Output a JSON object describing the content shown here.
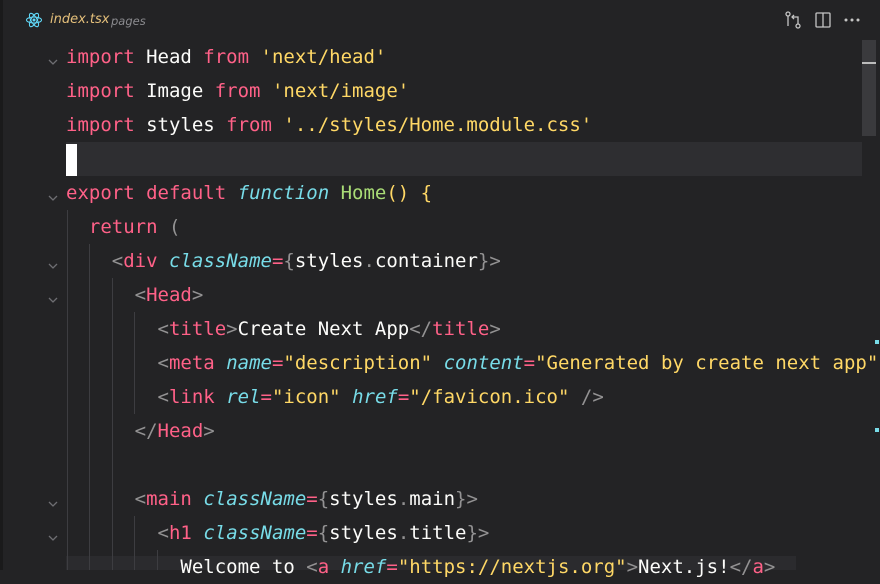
{
  "tab": {
    "filename": "index.tsx",
    "directory": "pages"
  },
  "lines": [
    [
      {
        "t": "import",
        "c": "kw"
      },
      {
        "t": " Head ",
        "c": "plain"
      },
      {
        "t": "from",
        "c": "kw"
      },
      {
        "t": " ",
        "c": "plain"
      },
      {
        "t": "'next/head'",
        "c": "str"
      }
    ],
    [
      {
        "t": "import",
        "c": "kw"
      },
      {
        "t": " Image ",
        "c": "plain"
      },
      {
        "t": "from",
        "c": "kw"
      },
      {
        "t": " ",
        "c": "plain"
      },
      {
        "t": "'next/image'",
        "c": "str"
      }
    ],
    [
      {
        "t": "import",
        "c": "kw"
      },
      {
        "t": " styles ",
        "c": "plain"
      },
      {
        "t": "from",
        "c": "kw"
      },
      {
        "t": " ",
        "c": "plain"
      },
      {
        "t": "'../styles/Home.module.css'",
        "c": "str"
      }
    ],
    [],
    [
      {
        "t": "export",
        "c": "kw"
      },
      {
        "t": " ",
        "c": "plain"
      },
      {
        "t": "default",
        "c": "kw"
      },
      {
        "t": " ",
        "c": "plain"
      },
      {
        "t": "function",
        "c": "italic-kw"
      },
      {
        "t": " ",
        "c": "plain"
      },
      {
        "t": "Home",
        "c": "fn"
      },
      {
        "t": "() {",
        "c": "brace"
      }
    ],
    [
      {
        "t": "  ",
        "c": "plain"
      },
      {
        "t": "return",
        "c": "kw"
      },
      {
        "t": " (",
        "c": "punc"
      }
    ],
    [
      {
        "t": "    ",
        "c": "plain"
      },
      {
        "t": "<",
        "c": "punc"
      },
      {
        "t": "div",
        "c": "tag"
      },
      {
        "t": " ",
        "c": "plain"
      },
      {
        "t": "className",
        "c": "prop"
      },
      {
        "t": "=",
        "c": "op"
      },
      {
        "t": "{",
        "c": "punc"
      },
      {
        "t": "styles",
        "c": "plain"
      },
      {
        "t": ".",
        "c": "punc"
      },
      {
        "t": "container",
        "c": "plain"
      },
      {
        "t": "}>",
        "c": "punc"
      }
    ],
    [
      {
        "t": "      ",
        "c": "plain"
      },
      {
        "t": "<",
        "c": "punc"
      },
      {
        "t": "Head",
        "c": "tag"
      },
      {
        "t": ">",
        "c": "punc"
      }
    ],
    [
      {
        "t": "        ",
        "c": "plain"
      },
      {
        "t": "<",
        "c": "punc"
      },
      {
        "t": "title",
        "c": "tag"
      },
      {
        "t": ">",
        "c": "punc"
      },
      {
        "t": "Create Next App",
        "c": "plain"
      },
      {
        "t": "</",
        "c": "punc"
      },
      {
        "t": "title",
        "c": "tag"
      },
      {
        "t": ">",
        "c": "punc"
      }
    ],
    [
      {
        "t": "        ",
        "c": "plain"
      },
      {
        "t": "<",
        "c": "punc"
      },
      {
        "t": "meta",
        "c": "tag"
      },
      {
        "t": " ",
        "c": "plain"
      },
      {
        "t": "name",
        "c": "prop"
      },
      {
        "t": "=",
        "c": "op"
      },
      {
        "t": "\"description\"",
        "c": "str"
      },
      {
        "t": " ",
        "c": "plain"
      },
      {
        "t": "content",
        "c": "prop"
      },
      {
        "t": "=",
        "c": "op"
      },
      {
        "t": "\"Generated by create next app\"",
        "c": "str"
      },
      {
        "t": " /",
        "c": "punc"
      }
    ],
    [
      {
        "t": "        ",
        "c": "plain"
      },
      {
        "t": "<",
        "c": "punc"
      },
      {
        "t": "link",
        "c": "tag"
      },
      {
        "t": " ",
        "c": "plain"
      },
      {
        "t": "rel",
        "c": "prop"
      },
      {
        "t": "=",
        "c": "op"
      },
      {
        "t": "\"icon\"",
        "c": "str"
      },
      {
        "t": " ",
        "c": "plain"
      },
      {
        "t": "href",
        "c": "prop"
      },
      {
        "t": "=",
        "c": "op"
      },
      {
        "t": "\"/favicon.ico\"",
        "c": "str"
      },
      {
        "t": " />",
        "c": "punc"
      }
    ],
    [
      {
        "t": "      ",
        "c": "plain"
      },
      {
        "t": "</",
        "c": "punc"
      },
      {
        "t": "Head",
        "c": "tag"
      },
      {
        "t": ">",
        "c": "punc"
      }
    ],
    [],
    [
      {
        "t": "      ",
        "c": "plain"
      },
      {
        "t": "<",
        "c": "punc"
      },
      {
        "t": "main",
        "c": "tag"
      },
      {
        "t": " ",
        "c": "plain"
      },
      {
        "t": "className",
        "c": "prop"
      },
      {
        "t": "=",
        "c": "op"
      },
      {
        "t": "{",
        "c": "punc"
      },
      {
        "t": "styles",
        "c": "plain"
      },
      {
        "t": ".",
        "c": "punc"
      },
      {
        "t": "main",
        "c": "plain"
      },
      {
        "t": "}>",
        "c": "punc"
      }
    ],
    [
      {
        "t": "        ",
        "c": "plain"
      },
      {
        "t": "<",
        "c": "punc"
      },
      {
        "t": "h1",
        "c": "tag"
      },
      {
        "t": " ",
        "c": "plain"
      },
      {
        "t": "className",
        "c": "prop"
      },
      {
        "t": "=",
        "c": "op"
      },
      {
        "t": "{",
        "c": "punc"
      },
      {
        "t": "styles",
        "c": "plain"
      },
      {
        "t": ".",
        "c": "punc"
      },
      {
        "t": "title",
        "c": "plain"
      },
      {
        "t": "}>",
        "c": "punc"
      }
    ],
    [
      {
        "t": "          ",
        "c": "plain"
      },
      {
        "t": "Welcome to ",
        "c": "plain"
      },
      {
        "t": "<",
        "c": "punc"
      },
      {
        "t": "a",
        "c": "tag"
      },
      {
        "t": " ",
        "c": "plain"
      },
      {
        "t": "href",
        "c": "prop"
      },
      {
        "t": "=",
        "c": "op"
      },
      {
        "t": "\"https://nextjs.org\"",
        "c": "str"
      },
      {
        "t": ">",
        "c": "punc"
      },
      {
        "t": "Next.js!",
        "c": "plain"
      },
      {
        "t": "</",
        "c": "punc"
      },
      {
        "t": "a",
        "c": "tag"
      },
      {
        "t": ">",
        "c": "punc"
      }
    ]
  ],
  "icons": {
    "tab": "react-icon",
    "compare": "git-compare-icon",
    "split": "split-editor-icon",
    "more": "more-actions-icon",
    "fold": "chevron-down-icon"
  },
  "colors": {
    "background": "#232325",
    "keyword": "#ff6188",
    "string": "#ffd866",
    "function": "#a9dc76",
    "property": "#78dce8"
  }
}
